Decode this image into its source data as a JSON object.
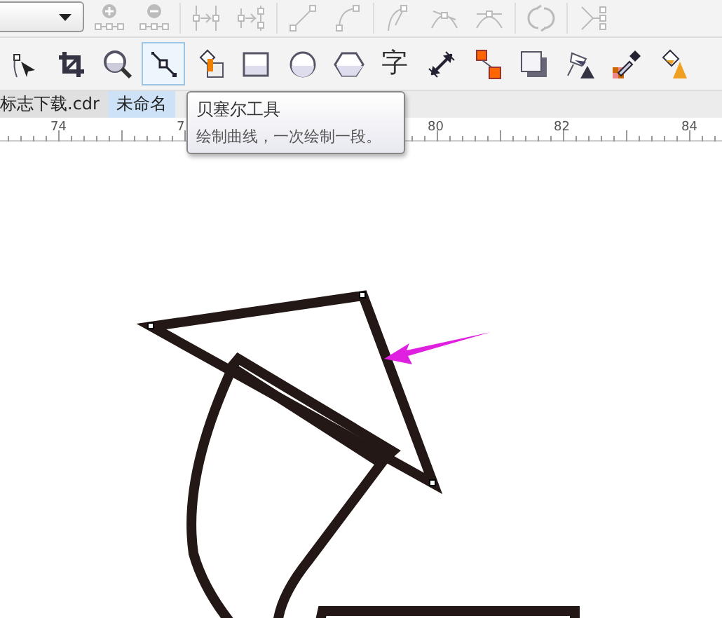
{
  "property_bar": {
    "tools": [
      {
        "kind": "add-node",
        "disabled": true
      },
      {
        "kind": "delete-node",
        "disabled": true
      },
      {
        "kind": "join-nodes",
        "disabled": true
      },
      {
        "kind": "break-curve",
        "disabled": true
      },
      {
        "kind": "to-line",
        "disabled": true
      },
      {
        "kind": "to-curve",
        "disabled": true
      },
      {
        "kind": "cusp",
        "disabled": true
      },
      {
        "kind": "smooth",
        "disabled": true
      },
      {
        "kind": "symmetric",
        "disabled": true
      },
      {
        "kind": "reverse",
        "disabled": true
      },
      {
        "kind": "extract",
        "disabled": true
      }
    ]
  },
  "toolbox": [
    {
      "kind": "pick",
      "selected": false
    },
    {
      "kind": "crop",
      "selected": false
    },
    {
      "kind": "zoom",
      "selected": false
    },
    {
      "kind": "bezier",
      "selected": true
    },
    {
      "kind": "smart-fill",
      "selected": false
    },
    {
      "kind": "rectangle",
      "selected": false
    },
    {
      "kind": "ellipse",
      "selected": false
    },
    {
      "kind": "polygon",
      "selected": false
    },
    {
      "kind": "text",
      "label": "字",
      "selected": false
    },
    {
      "kind": "dimension",
      "selected": false
    },
    {
      "kind": "connector",
      "selected": false
    },
    {
      "kind": "shadow",
      "selected": false
    },
    {
      "kind": "transparency",
      "selected": false
    },
    {
      "kind": "eyedropper",
      "selected": false
    },
    {
      "kind": "fill",
      "selected": false
    }
  ],
  "tabs": [
    {
      "label": "标志下载.cdr",
      "selected": false
    },
    {
      "label": "未命名",
      "selected": true
    }
  ],
  "tooltip": {
    "title": "贝塞尔工具",
    "description": "绘制曲线，一次绘制一段。"
  },
  "ruler": {
    "labels": [
      "74",
      "7",
      "80",
      "82",
      "84"
    ]
  }
}
